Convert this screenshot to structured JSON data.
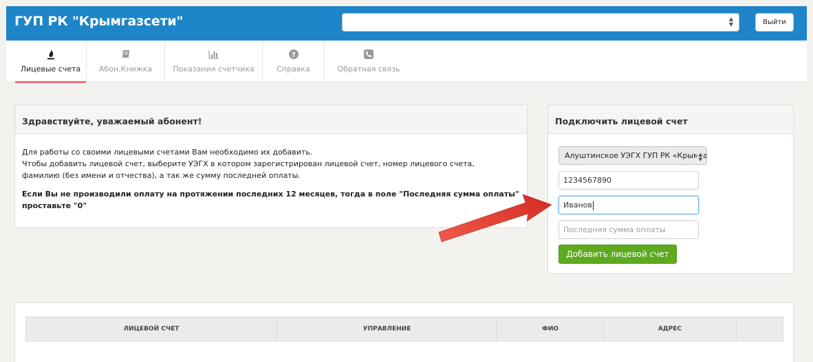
{
  "header": {
    "brand": "ГУП РК \"Крымгазсети\"",
    "select_value": "",
    "logout_label": "Выйти",
    "color": "#1e85c8"
  },
  "tabs": [
    {
      "label": "Лицевые счета",
      "icon": "flame-icon",
      "active": true
    },
    {
      "label": "Абон.Книжка",
      "icon": "book-icon",
      "active": false
    },
    {
      "label": "Показания счетчика",
      "icon": "bar-chart-icon",
      "active": false
    },
    {
      "label": "Справка",
      "icon": "help-icon",
      "active": false
    },
    {
      "label": "Обратная связь",
      "icon": "phone-icon",
      "active": false
    }
  ],
  "welcome": {
    "title": "Здравствуйте, уважаемый абонент!",
    "line1": "Для работы со своими лицевыми счетами Вам необходимо их добавить.",
    "line2": "Чтобы добавить лицевой счет, выберите УЭГХ в котором зарегистрирован лицевой счет, номер лицевого счета,",
    "line3": "фамилию (без имени и отчества), а так же сумму последней оплаты.",
    "note": "Если Вы не производили оплату на протяжении последних 12 месяцев, тогда в поле \"Последняя сумма оплаты\" проставьте \"0\""
  },
  "connect": {
    "title": "Подключить лицевой счет",
    "select_value": "Алуштинское УЭГХ ГУП РК «Крымгазсети»",
    "account_value": "1234567890",
    "surname_value": "Иванов",
    "amount_placeholder": "Последняя сумма оплаты",
    "add_button": "Добавить лицевой счет",
    "button_color": "#5daa1e"
  },
  "table": {
    "columns": [
      "ЛИЦЕВОЙ СЧЕТ",
      "УПРАВЛЕНИЕ",
      "ФИО",
      "АДРЕС",
      ""
    ]
  },
  "annotation": {
    "color": "#e0392e"
  }
}
